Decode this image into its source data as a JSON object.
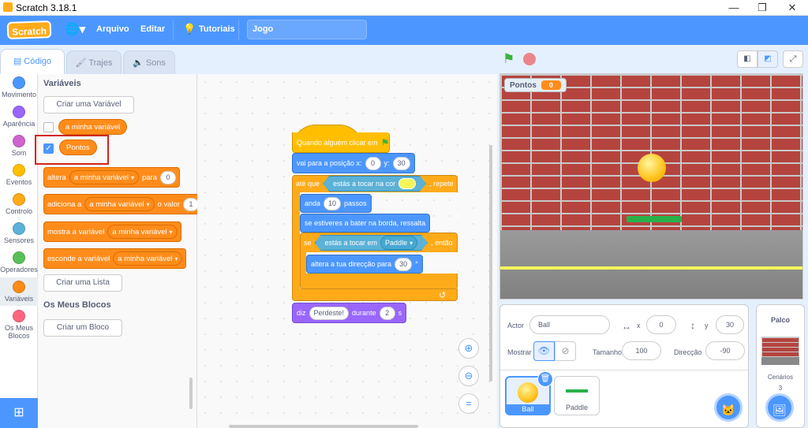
{
  "window": {
    "title": "Scratch 3.18.1",
    "minimize": "—",
    "restore": "❐",
    "close": "✕"
  },
  "menu": {
    "logo": "Scratch",
    "file": "Arquivo",
    "edit": "Editar",
    "tutorials": "Tutoriais",
    "project_title": "Jogo"
  },
  "tabs": {
    "code": "Código",
    "costumes": "Trajes",
    "sounds": "Sons"
  },
  "categories": [
    {
      "label": "Movimento",
      "color": "#4c97ff"
    },
    {
      "label": "Aparência",
      "color": "#9966ff"
    },
    {
      "label": "Som",
      "color": "#cf63cf"
    },
    {
      "label": "Eventos",
      "color": "#ffbf00"
    },
    {
      "label": "Controlo",
      "color": "#ffab19"
    },
    {
      "label": "Sensores",
      "color": "#5cb1d6"
    },
    {
      "label": "Operadores",
      "color": "#59c059"
    },
    {
      "label": "Variáveis",
      "color": "#ff8c1a"
    },
    {
      "label": "Os Meus Blocos",
      "color": "#ff6680"
    }
  ],
  "palette": {
    "variables_heading": "Variáveis",
    "make_variable": "Criar uma Variável",
    "var1": "a minha variável",
    "var2": "Pontos",
    "set_block": {
      "verb": "altera",
      "var": "a minha variável",
      "prep": "para",
      "value": "0"
    },
    "change_block": {
      "verb": "adiciona a",
      "var": "a minha variável",
      "prep": "o valor",
      "value": "1"
    },
    "show_block": {
      "verb": "mostra a variável",
      "var": "a minha variável"
    },
    "hide_block": {
      "verb": "esconde a variável",
      "var": "a minha variável"
    },
    "make_list": "Criar uma Lista",
    "myblocks_heading": "Os Meus Blocos",
    "make_block": "Criar um Bloco"
  },
  "script": {
    "hat": "Quando alguém clicar em",
    "goto": {
      "label": "vai para a posição x:",
      "x": "0",
      "y_label": "y:",
      "y": "30"
    },
    "until": {
      "label": "até que",
      "sensing": "estás a tocar na cor",
      "repeat": ", repete"
    },
    "move": {
      "label": "anda",
      "value": "10",
      "unit": "passos"
    },
    "bounce": "se estiveres a bater na borda, ressalta",
    "if": {
      "label": "se",
      "sensing": "estás a tocar em",
      "target": "Paddle",
      "then": ", então"
    },
    "turn": {
      "label": "altera a tua direcção para",
      "value": "30",
      "unit": "°"
    },
    "say": {
      "label": "diz",
      "text": "Perdeste!",
      "for": "durante",
      "value": "2",
      "unit": "s"
    }
  },
  "stage": {
    "monitor_label": "Pontos",
    "monitor_value": "0"
  },
  "sprite_info": {
    "actor_label": "Actor",
    "actor_name": "Ball",
    "x_label": "x",
    "x": "0",
    "y_label": "y",
    "y": "30",
    "show_label": "Mostrar",
    "size_label": "Tamanho",
    "size": "100",
    "direction_label": "Direcção",
    "direction": "-90"
  },
  "sprites": [
    {
      "name": "Ball"
    },
    {
      "name": "Paddle"
    }
  ],
  "stage_panel": {
    "title": "Palco",
    "backdrops_label": "Cenários",
    "backdrops_count": "3"
  }
}
